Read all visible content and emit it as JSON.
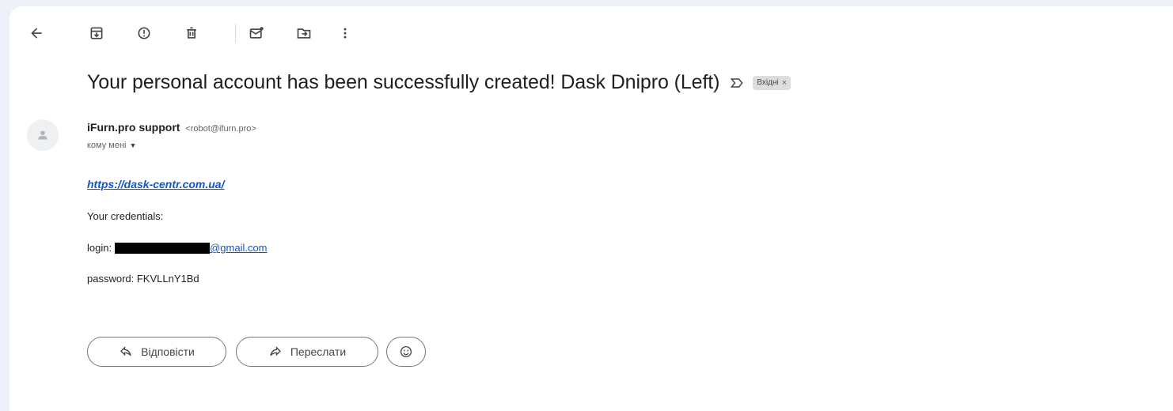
{
  "toolbar": {
    "icons": [
      "back-arrow-icon",
      "archive-icon",
      "report-spam-icon",
      "delete-icon",
      "mark-unread-icon",
      "move-to-icon",
      "more-vert-icon"
    ]
  },
  "email": {
    "subject": "Your personal account has been successfully created! Dask Dnipro (Left)",
    "label": "Вхідні",
    "label_remove": "×",
    "sender": {
      "name": "iFurn.pro support",
      "email": "<robot@ifurn.pro>"
    },
    "to_line": "кому мені",
    "body": {
      "link": "https://dask-centr.com.ua/",
      "credentials_title": "Your credentials:",
      "login_prefix": "login:",
      "login_visible": "@gmail.com",
      "password_line": "password: FKVLLnY1Bd"
    }
  },
  "actions": {
    "reply_label": "Відповісти",
    "forward_label": "Переслати"
  },
  "colors": {
    "link": "#1155cc",
    "page_bg": "#eef1f8",
    "chip_bg": "#dddddd"
  }
}
